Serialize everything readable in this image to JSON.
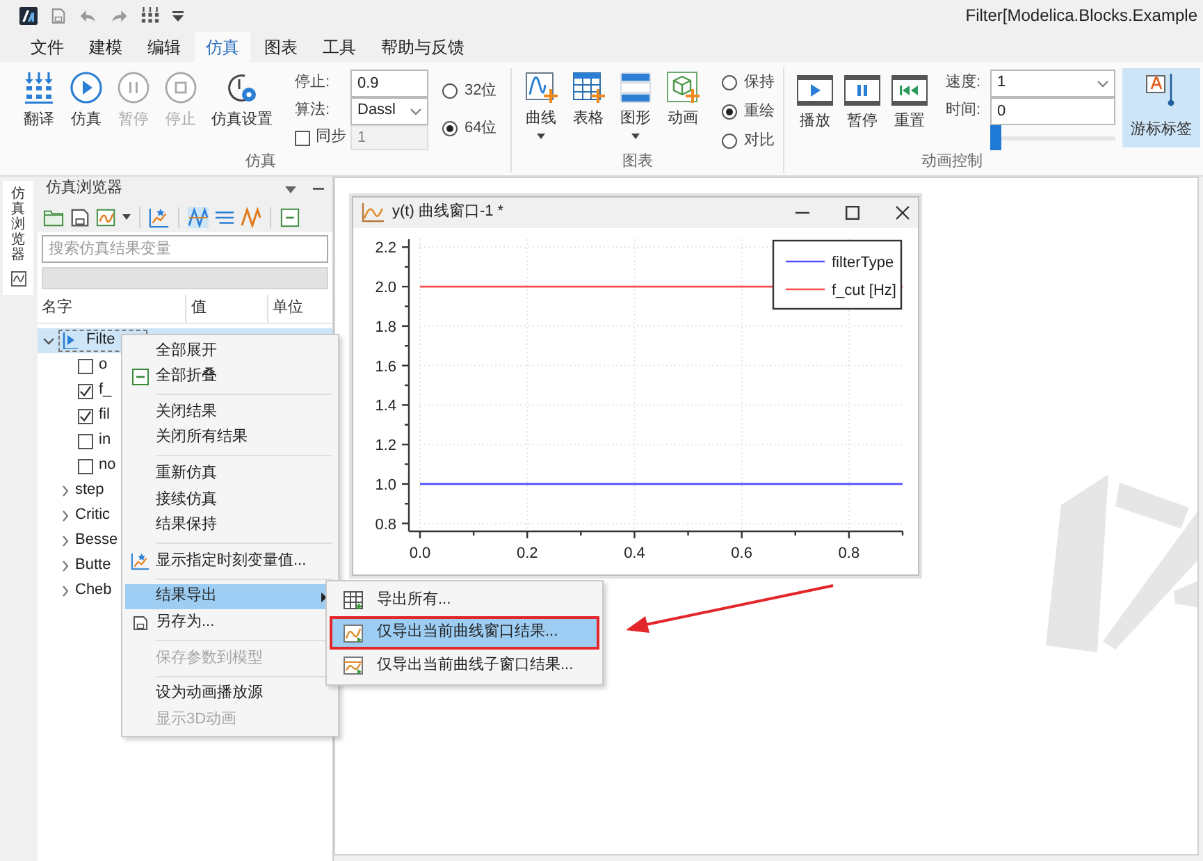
{
  "title_bar": {
    "title": "Filter[Modelica.Blocks.Example"
  },
  "menu_tabs": [
    {
      "label": "文件",
      "selected": false
    },
    {
      "label": "建模",
      "selected": false
    },
    {
      "label": "编辑",
      "selected": false
    },
    {
      "label": "仿真",
      "selected": true
    },
    {
      "label": "图表",
      "selected": false
    },
    {
      "label": "工具",
      "selected": false
    },
    {
      "label": "帮助与反馈",
      "selected": false
    }
  ],
  "ribbon": {
    "simulation": {
      "label": "仿真",
      "buttons": [
        {
          "label": "翻译",
          "disabled": false
        },
        {
          "label": "仿真",
          "disabled": false
        },
        {
          "label": "暂停",
          "disabled": true
        },
        {
          "label": "停止",
          "disabled": true
        },
        {
          "label": "仿真设置",
          "disabled": false
        }
      ],
      "stop_time": {
        "label": "停止:",
        "value": "0.9"
      },
      "algorithm": {
        "label": "算法:",
        "value": "Dassl"
      },
      "sync": {
        "label": "同步",
        "checked": false,
        "value": "1",
        "disabled": true
      },
      "precision": [
        {
          "label": "32位",
          "selected": false
        },
        {
          "label": "64位",
          "selected": true
        }
      ]
    },
    "charts": {
      "label": "图表",
      "buttons": [
        {
          "label": "曲线",
          "dropdown": true
        },
        {
          "label": "表格",
          "dropdown": false
        },
        {
          "label": "图形",
          "dropdown": true
        },
        {
          "label": "动画",
          "dropdown": false
        }
      ],
      "modes": [
        {
          "label": "保持",
          "selected": false
        },
        {
          "label": "重绘",
          "selected": true
        },
        {
          "label": "对比",
          "selected": false
        }
      ]
    },
    "animation": {
      "label": "动画控制",
      "buttons": [
        {
          "label": "播放"
        },
        {
          "label": "暂停"
        },
        {
          "label": "重置"
        }
      ],
      "speed": {
        "label": "速度:",
        "value": "1"
      },
      "time": {
        "label": "时间:",
        "value": "0"
      },
      "timeline": {
        "level": 0
      },
      "cursor_label": {
        "label": "游标标签",
        "selected": true
      }
    }
  },
  "side_tab": {
    "label": "仿真浏览器",
    "selected": true
  },
  "browser": {
    "title": "仿真浏览器",
    "search": {
      "placeholder": "搜索仿真结果变量"
    },
    "columns": [
      "名字",
      "值",
      "单位"
    ],
    "tree": [
      {
        "label": "Filte",
        "expanded": true,
        "selected": true,
        "children": [
          {
            "kind": "variable",
            "label": "o",
            "checked": false,
            "selected": false
          },
          {
            "kind": "variable",
            "label": "f_",
            "checked": true,
            "selected": false
          },
          {
            "kind": "variable",
            "label": "fil",
            "checked": true,
            "selected": false
          },
          {
            "kind": "variable",
            "label": "in",
            "checked": false,
            "selected": false
          },
          {
            "kind": "variable",
            "label": "no",
            "checked": false,
            "selected": false
          },
          {
            "kind": "component",
            "label": "step",
            "expanded": false,
            "selected": false
          },
          {
            "kind": "component",
            "label": "Critic",
            "expanded": false,
            "selected": false
          },
          {
            "kind": "component",
            "label": "Besse",
            "expanded": false,
            "selected": false
          },
          {
            "kind": "component",
            "label": "Butte",
            "expanded": false,
            "selected": false
          },
          {
            "kind": "component",
            "label": "Cheb",
            "expanded": false,
            "selected": false
          }
        ]
      }
    ]
  },
  "chart_window": {
    "title": "y(t) 曲线窗口-1 *",
    "chart_data": {
      "type": "line",
      "x": [
        0,
        0.9
      ],
      "series": [
        {
          "name": "filterType",
          "color": "#4f4fff",
          "values": [
            1,
            1
          ]
        },
        {
          "name": "f_cut [Hz]",
          "color": "#ff4f4f",
          "values": [
            2,
            2
          ]
        }
      ],
      "xlim": [
        0,
        0.9
      ],
      "ylim": [
        0.76,
        2.24
      ],
      "xticks": [
        {
          "value": 0,
          "label": "0.0"
        },
        0.2,
        0.4,
        0.6,
        0.8
      ],
      "yticks": [
        0.8,
        {
          "value": 1,
          "label": "1.0"
        },
        1.2,
        1.4,
        1.6,
        1.8,
        {
          "value": 2,
          "label": "2.0"
        },
        2.2
      ],
      "grid": true,
      "legend": true
    }
  },
  "context_menu": {
    "items": [
      {
        "kind": "item",
        "label": "全部展开",
        "selected": false,
        "disabled": false
      },
      {
        "kind": "item",
        "label": "全部折叠",
        "selected": false,
        "disabled": false
      },
      {
        "kind": "separator"
      },
      {
        "kind": "item",
        "label": "关闭结果",
        "selected": false,
        "disabled": false
      },
      {
        "kind": "item",
        "label": "关闭所有结果",
        "selected": false,
        "disabled": false
      },
      {
        "kind": "separator"
      },
      {
        "kind": "item",
        "label": "重新仿真",
        "selected": false,
        "disabled": false
      },
      {
        "kind": "item",
        "label": "接续仿真",
        "selected": false,
        "disabled": false
      },
      {
        "kind": "item",
        "label": "结果保持",
        "selected": false,
        "disabled": false
      },
      {
        "kind": "separator"
      },
      {
        "kind": "item",
        "label": "显示指定时刻变量值...",
        "selected": false,
        "disabled": false
      },
      {
        "kind": "separator"
      },
      {
        "kind": "item",
        "label": "结果导出",
        "selected": true,
        "disabled": false,
        "submenu": [
          {
            "label": "导出所有...",
            "selected": false,
            "annotated": false
          },
          {
            "label": "仅导出当前曲线窗口结果...",
            "selected": true,
            "annotated": true
          },
          {
            "label": "仅导出当前曲线子窗口结果...",
            "selected": false,
            "annotated": false
          }
        ]
      },
      {
        "kind": "item",
        "label": "另存为...",
        "selected": false,
        "disabled": false
      },
      {
        "kind": "separator"
      },
      {
        "kind": "item",
        "label": "保存参数到模型",
        "selected": false,
        "disabled": true
      },
      {
        "kind": "separator"
      },
      {
        "kind": "item",
        "label": "设为动画播放源",
        "selected": false,
        "disabled": false
      },
      {
        "kind": "item",
        "label": "显示3D动画",
        "selected": false,
        "disabled": true
      }
    ]
  }
}
